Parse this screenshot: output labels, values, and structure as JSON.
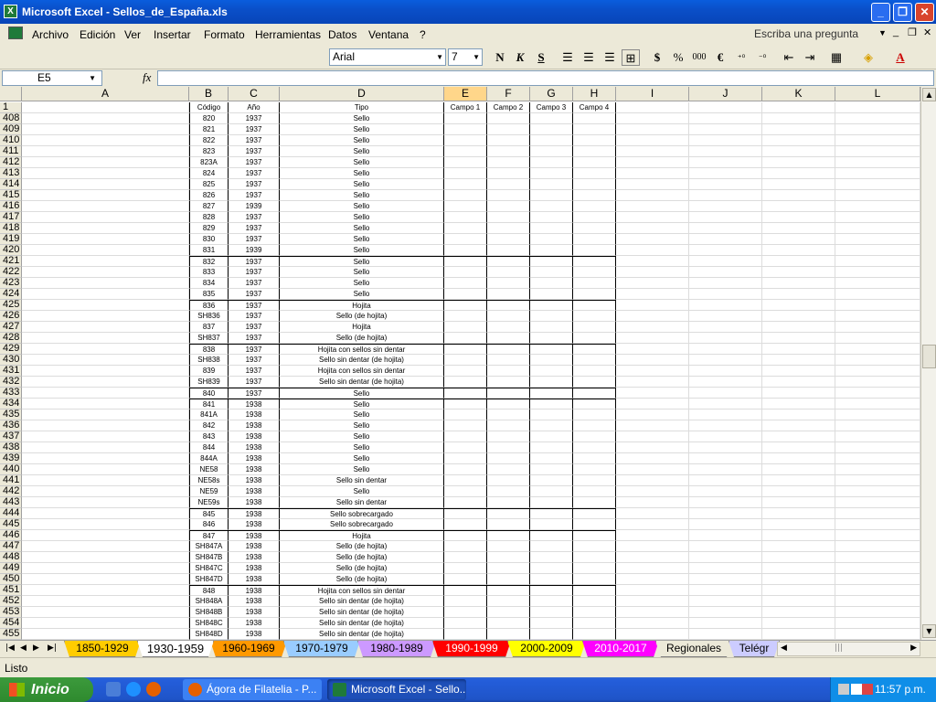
{
  "window": {
    "title": "Microsoft Excel - Sellos_de_España.xls"
  },
  "menu": {
    "items": [
      "Archivo",
      "Edición",
      "Ver",
      "Insertar",
      "Formato",
      "Herramientas",
      "Datos",
      "Ventana",
      "?"
    ],
    "ask_placeholder": "Escriba una pregunta"
  },
  "toolbar": {
    "font": "Arial",
    "size": "7",
    "bold": "N",
    "italic": "K",
    "underline": "S",
    "currency": "$",
    "percent": "%",
    "thousands": "000",
    "euro": "€"
  },
  "formula": {
    "namebox": "E5",
    "fx": "fx",
    "content": ""
  },
  "columns": [
    "A",
    "B",
    "C",
    "D",
    "E",
    "F",
    "G",
    "H",
    "I",
    "J",
    "K",
    "L"
  ],
  "header_row": {
    "row": "1",
    "B": "Código",
    "C": "Año",
    "D": "Tipo",
    "E": "Campo 1",
    "F": "Campo 2",
    "G": "Campo 3",
    "H": "Campo 4"
  },
  "rows": [
    {
      "n": "408",
      "code": "820",
      "year": "1937",
      "tipo": "Sello"
    },
    {
      "n": "409",
      "code": "821",
      "year": "1937",
      "tipo": "Sello"
    },
    {
      "n": "410",
      "code": "822",
      "year": "1937",
      "tipo": "Sello"
    },
    {
      "n": "411",
      "code": "823",
      "year": "1937",
      "tipo": "Sello"
    },
    {
      "n": "412",
      "code": "823A",
      "year": "1937",
      "tipo": "Sello"
    },
    {
      "n": "413",
      "code": "824",
      "year": "1937",
      "tipo": "Sello"
    },
    {
      "n": "414",
      "code": "825",
      "year": "1937",
      "tipo": "Sello"
    },
    {
      "n": "415",
      "code": "826",
      "year": "1937",
      "tipo": "Sello"
    },
    {
      "n": "416",
      "code": "827",
      "year": "1939",
      "tipo": "Sello"
    },
    {
      "n": "417",
      "code": "828",
      "year": "1937",
      "tipo": "Sello"
    },
    {
      "n": "418",
      "code": "829",
      "year": "1937",
      "tipo": "Sello"
    },
    {
      "n": "419",
      "code": "830",
      "year": "1937",
      "tipo": "Sello"
    },
    {
      "n": "420",
      "code": "831",
      "year": "1939",
      "tipo": "Sello"
    },
    {
      "n": "421",
      "code": "832",
      "year": "1937",
      "tipo": "Sello",
      "top": true
    },
    {
      "n": "422",
      "code": "833",
      "year": "1937",
      "tipo": "Sello"
    },
    {
      "n": "423",
      "code": "834",
      "year": "1937",
      "tipo": "Sello"
    },
    {
      "n": "424",
      "code": "835",
      "year": "1937",
      "tipo": "Sello"
    },
    {
      "n": "425",
      "code": "836",
      "year": "1937",
      "tipo": "Hojita",
      "top": true
    },
    {
      "n": "426",
      "code": "SH836",
      "year": "1937",
      "tipo": "Sello (de hojita)"
    },
    {
      "n": "427",
      "code": "837",
      "year": "1937",
      "tipo": "Hojita"
    },
    {
      "n": "428",
      "code": "SH837",
      "year": "1937",
      "tipo": "Sello (de hojita)"
    },
    {
      "n": "429",
      "code": "838",
      "year": "1937",
      "tipo": "Hojita con sellos sin dentar",
      "top": true
    },
    {
      "n": "430",
      "code": "SH838",
      "year": "1937",
      "tipo": "Sello sin dentar (de hojita)"
    },
    {
      "n": "431",
      "code": "839",
      "year": "1937",
      "tipo": "Hojita con sellos sin dentar"
    },
    {
      "n": "432",
      "code": "SH839",
      "year": "1937",
      "tipo": "Sello sin dentar (de hojita)"
    },
    {
      "n": "433",
      "code": "840",
      "year": "1937",
      "tipo": "Sello",
      "top": true
    },
    {
      "n": "434",
      "code": "841",
      "year": "1938",
      "tipo": "Sello",
      "top": true
    },
    {
      "n": "435",
      "code": "841A",
      "year": "1938",
      "tipo": "Sello"
    },
    {
      "n": "436",
      "code": "842",
      "year": "1938",
      "tipo": "Sello"
    },
    {
      "n": "437",
      "code": "843",
      "year": "1938",
      "tipo": "Sello"
    },
    {
      "n": "438",
      "code": "844",
      "year": "1938",
      "tipo": "Sello"
    },
    {
      "n": "439",
      "code": "844A",
      "year": "1938",
      "tipo": "Sello"
    },
    {
      "n": "440",
      "code": "NE58",
      "year": "1938",
      "tipo": "Sello"
    },
    {
      "n": "441",
      "code": "NE58s",
      "year": "1938",
      "tipo": "Sello sin dentar"
    },
    {
      "n": "442",
      "code": "NE59",
      "year": "1938",
      "tipo": "Sello"
    },
    {
      "n": "443",
      "code": "NE59s",
      "year": "1938",
      "tipo": "Sello sin dentar"
    },
    {
      "n": "444",
      "code": "845",
      "year": "1938",
      "tipo": "Sello sobrecargado",
      "top": true
    },
    {
      "n": "445",
      "code": "846",
      "year": "1938",
      "tipo": "Sello sobrecargado"
    },
    {
      "n": "446",
      "code": "847",
      "year": "1938",
      "tipo": "Hojita",
      "top": true
    },
    {
      "n": "447",
      "code": "SH847A",
      "year": "1938",
      "tipo": "Sello (de hojita)"
    },
    {
      "n": "448",
      "code": "SH847B",
      "year": "1938",
      "tipo": "Sello (de hojita)"
    },
    {
      "n": "449",
      "code": "SH847C",
      "year": "1938",
      "tipo": "Sello (de hojita)"
    },
    {
      "n": "450",
      "code": "SH847D",
      "year": "1938",
      "tipo": "Sello (de hojita)"
    },
    {
      "n": "451",
      "code": "848",
      "year": "1938",
      "tipo": "Hojita con sellos sin dentar",
      "top": true
    },
    {
      "n": "452",
      "code": "SH848A",
      "year": "1938",
      "tipo": "Sello sin dentar (de hojita)"
    },
    {
      "n": "453",
      "code": "SH848B",
      "year": "1938",
      "tipo": "Sello sin dentar (de hojita)"
    },
    {
      "n": "454",
      "code": "SH848C",
      "year": "1938",
      "tipo": "Sello sin dentar (de hojita)"
    },
    {
      "n": "455",
      "code": "SH848D",
      "year": "1938",
      "tipo": "Sello sin dentar (de hojita)"
    }
  ],
  "tabs": [
    {
      "label": "1850-1929",
      "color": "#ffcc00"
    },
    {
      "label": "1930-1959",
      "color": "#ffffff",
      "active": true
    },
    {
      "label": "1960-1969",
      "color": "#ff9900"
    },
    {
      "label": "1970-1979",
      "color": "#99ccff"
    },
    {
      "label": "1980-1989",
      "color": "#cc99ff"
    },
    {
      "label": "1990-1999",
      "color": "#ff0000"
    },
    {
      "label": "2000-2009",
      "color": "#ffff00"
    },
    {
      "label": "2010-2017",
      "color": "#ff00ff"
    },
    {
      "label": "Regionales",
      "color": "#ece9d8"
    },
    {
      "label": "Telégr",
      "color": "#ccccff"
    }
  ],
  "status": {
    "text": "Listo"
  },
  "taskbar": {
    "start": "Inicio",
    "tasks": [
      "Ágora de Filatelia - P...",
      "Microsoft Excel - Sello..."
    ],
    "clock": "11:57 p.m."
  }
}
